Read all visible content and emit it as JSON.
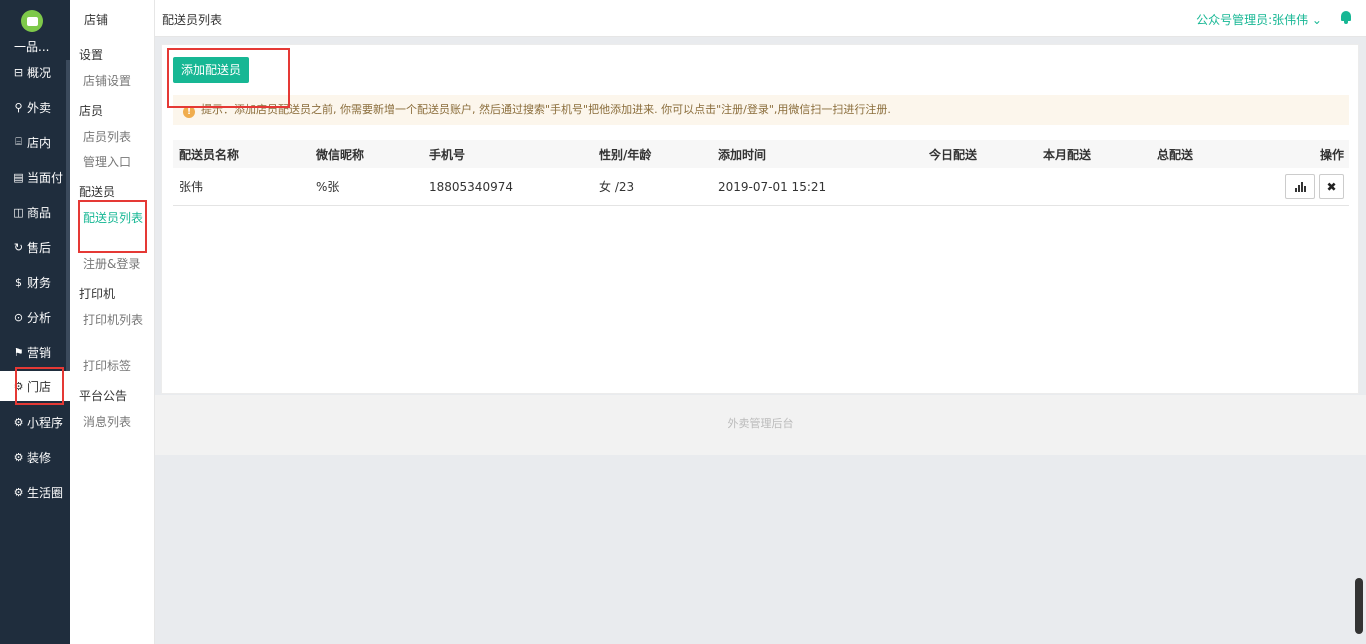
{
  "brand": {
    "logo_text": "一品..."
  },
  "nav": [
    {
      "label": "概况",
      "icon": "grid-icon",
      "glyph": "⊟"
    },
    {
      "label": "外卖",
      "icon": "scooter-icon",
      "glyph": "⚲"
    },
    {
      "label": "店内",
      "icon": "store-icon",
      "glyph": "⌸"
    },
    {
      "label": "当面付",
      "icon": "receipt-icon",
      "glyph": "▤"
    },
    {
      "label": "商品",
      "icon": "bag-icon",
      "glyph": "◫"
    },
    {
      "label": "售后",
      "icon": "refresh-icon",
      "glyph": "↻"
    },
    {
      "label": "财务",
      "icon": "coin-icon",
      "glyph": "$"
    },
    {
      "label": "分析",
      "icon": "analysis-icon",
      "glyph": "⊙"
    },
    {
      "label": "营销",
      "icon": "flag-icon",
      "glyph": "⚑"
    },
    {
      "label": "门店",
      "icon": "gear-icon",
      "glyph": "⚙"
    },
    {
      "label": "小程序",
      "icon": "gear-icon",
      "glyph": "⚙"
    },
    {
      "label": "装修",
      "icon": "gear-icon",
      "glyph": "⚙"
    },
    {
      "label": "生活圈",
      "icon": "gear-icon",
      "glyph": "⚙"
    }
  ],
  "sub": {
    "title": "店铺",
    "groups": [
      {
        "label": "设置",
        "items": [
          "店铺设置"
        ]
      },
      {
        "label": "店员",
        "items": [
          "店员列表",
          "管理入口"
        ]
      },
      {
        "label": "配送员",
        "items": [
          "配送员列表",
          "注册&登录"
        ]
      },
      {
        "label": "打印机",
        "items": [
          "打印机列表",
          "打印标签"
        ]
      },
      {
        "label": "平台公告",
        "items": [
          "消息列表"
        ]
      }
    ]
  },
  "header": {
    "title": "配送员列表",
    "user": "公众号管理员:张伟伟 ⌄"
  },
  "content": {
    "add_button": "添加配送员",
    "tip": "提示：添加店员配送员之前, 你需要新增一个配送员账户, 然后通过搜索\"手机号\"把他添加进来. 你可以点击\"注册/登录\",用微信扫一扫进行注册."
  },
  "table": {
    "columns": [
      "配送员名称",
      "微信昵称",
      "手机号",
      "性别/年龄",
      "添加时间",
      "今日配送",
      "本月配送",
      "总配送",
      "操作"
    ],
    "rows": [
      {
        "name": "张伟",
        "nickname": "%张",
        "phone": "18805340974",
        "gender_age": "女 /23",
        "added": "2019-07-01 15:21",
        "today": "",
        "month": "",
        "total": ""
      }
    ]
  },
  "footer": {
    "text": "外卖管理后台"
  },
  "colors": {
    "accent": "#17b794",
    "nav_bg": "#1f2d3d",
    "annotation": "#e53935"
  }
}
